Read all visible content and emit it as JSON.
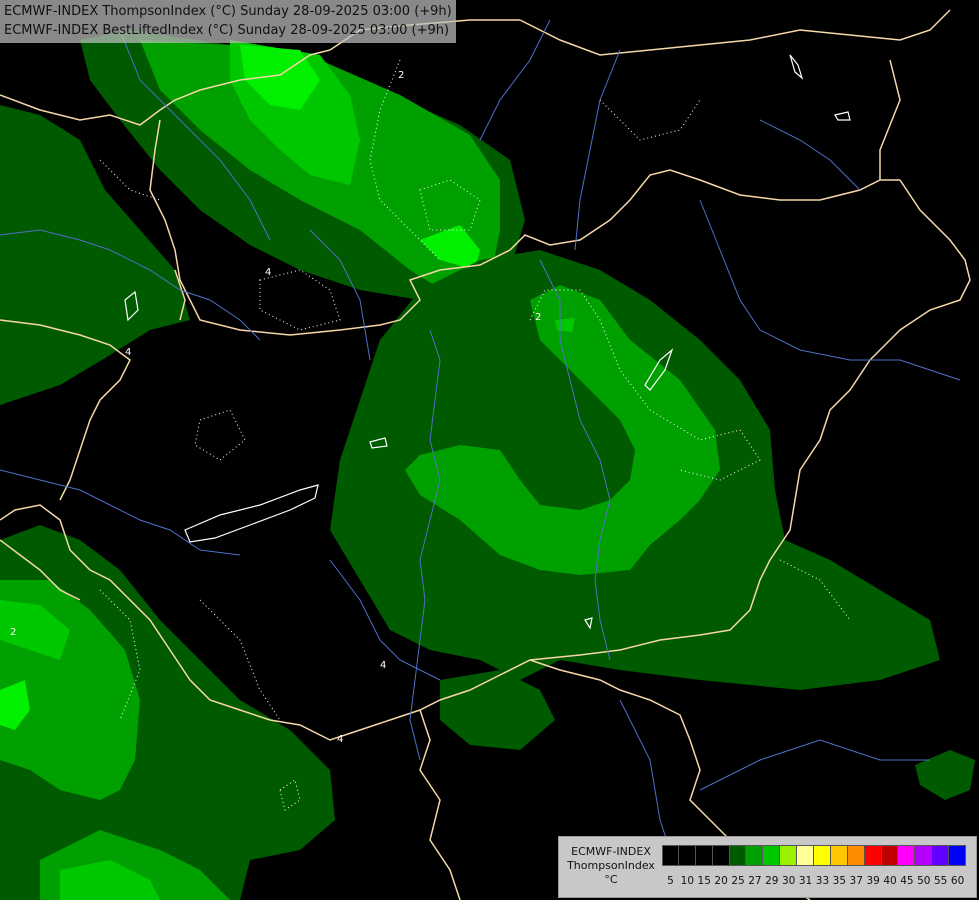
{
  "header": {
    "line1": "ECMWF-INDEX ThompsonIndex (°C) Sunday 28-09-2025 03:00 (+9h)",
    "line2": "ECMWF-INDEX BestLiftedIndex (°C) Sunday 28-09-2025 03:00 (+9h)"
  },
  "legend": {
    "title_line1": "ECMWF-INDEX",
    "title_line2": "ThompsonIndex",
    "title_line3": "°C",
    "ticks": [
      "5",
      "10",
      "15",
      "20",
      "25",
      "27",
      "29",
      "30",
      "31",
      "33",
      "35",
      "37",
      "39",
      "40",
      "45",
      "50",
      "55",
      "60"
    ],
    "colors": [
      "#000000",
      "#000000",
      "#000000",
      "#000000",
      "#005a00",
      "#00a000",
      "#00c800",
      "#9bf000",
      "#ffff96",
      "#ffff00",
      "#ffc800",
      "#ff8c00",
      "#ff0000",
      "#c00000",
      "#ff00ff",
      "#b400ff",
      "#6400ff",
      "#0000ff"
    ]
  },
  "map": {
    "colors": {
      "background": "#000000",
      "dark_green": "#005a00",
      "mid_green": "#00a000",
      "light_green": "#00c800",
      "bright_green": "#00f000",
      "border": "#f5d7a8",
      "river": "#5070c8",
      "contour": "#ffffff"
    },
    "contour_labels": [
      "2",
      "4",
      "2",
      "4",
      "4",
      "2",
      "4"
    ]
  }
}
